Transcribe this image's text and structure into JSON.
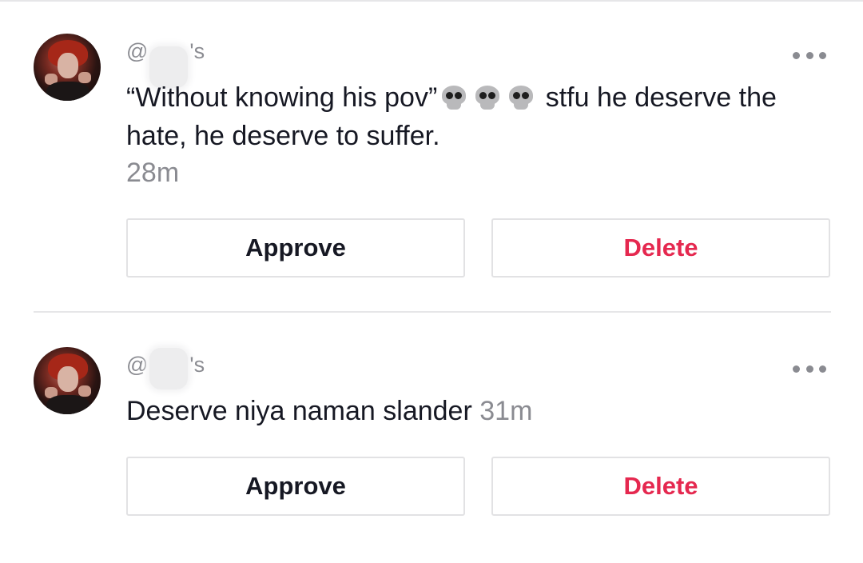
{
  "comments": [
    {
      "username_prefix": "@",
      "username_suffix": "'s",
      "text_before": "“Without knowing his pov”",
      "text_after": " stfu he deserve the hate, he deserve to suffer.",
      "time": "28m",
      "approve_label": "Approve",
      "delete_label": "Delete",
      "icons": [
        "avatar",
        "skull-emoji",
        "skull-emoji",
        "skull-emoji",
        "more-options-icon"
      ]
    },
    {
      "username_prefix": "@",
      "username_suffix": "'s",
      "text": "Deserve niya naman slander",
      "time": "31m",
      "approve_label": "Approve",
      "delete_label": "Delete",
      "icons": [
        "avatar",
        "more-options-icon"
      ]
    }
  ],
  "colors": {
    "text": "#161823",
    "muted": "#8a8b91",
    "delete": "#e5284f",
    "border": "#e2e2e4"
  }
}
